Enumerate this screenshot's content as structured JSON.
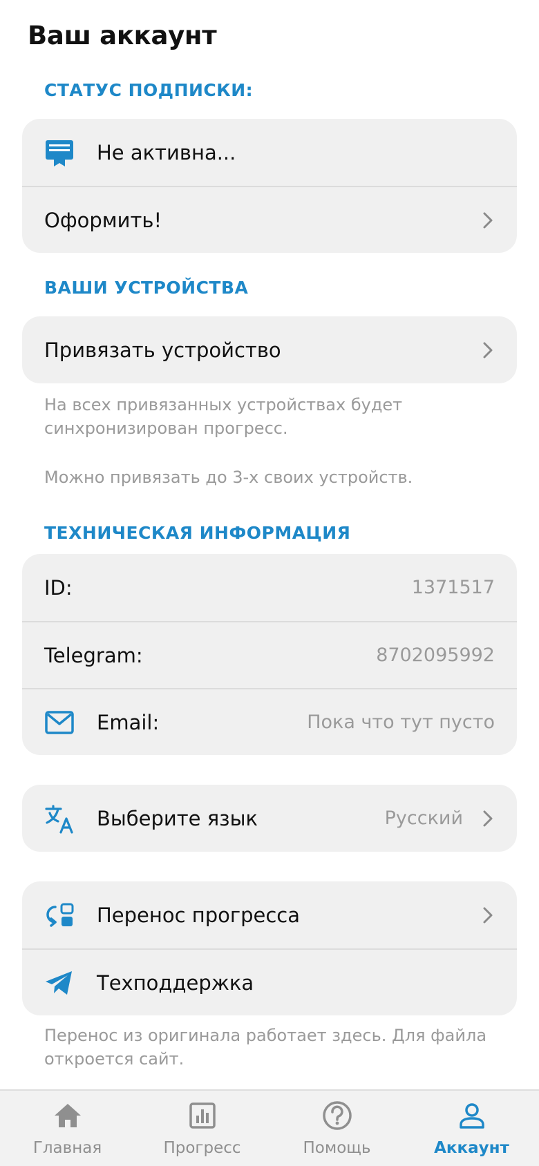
{
  "page": {
    "title": "Ваш аккаунт"
  },
  "subscription": {
    "header": "СТАТУС ПОДПИСКИ:",
    "status_label": "Не активна...",
    "subscribe_label": "Оформить!"
  },
  "devices": {
    "header": "ВАШИ УСТРОЙСТВА",
    "link_label": "Привязать устройство",
    "note_sync": "На всех привязанных устройствах будет синхронизирован прогресс.",
    "note_limit": "Можно привязать до 3-х своих устройств."
  },
  "tech": {
    "header": "ТЕХНИЧЕСКАЯ ИНФОРМАЦИЯ",
    "id_label": "ID:",
    "id_value": "1371517",
    "telegram_label": "Telegram:",
    "telegram_value": "8702095992",
    "email_label": "Email:",
    "email_value": "Пока что тут пусто"
  },
  "language": {
    "label": "Выберите язык",
    "value": "Русский"
  },
  "misc": {
    "transfer_label": "Перенос прогресса",
    "support_label": "Техподдержка",
    "note": "Перенос из оригинала работает здесь. Для файла откроется сайт."
  },
  "bottom_nav": {
    "items": [
      {
        "label": "Главная",
        "icon": "home-icon"
      },
      {
        "label": "Прогресс",
        "icon": "chart-icon"
      },
      {
        "label": "Помощь",
        "icon": "help-icon"
      },
      {
        "label": "Аккаунт",
        "icon": "user-icon"
      }
    ],
    "active": "Аккаунт"
  },
  "colors": {
    "accent": "#1e88c8",
    "card_bg": "#f0f0f0",
    "muted_text": "#9a9a9a",
    "nav_inactive": "#8f8f8f"
  }
}
